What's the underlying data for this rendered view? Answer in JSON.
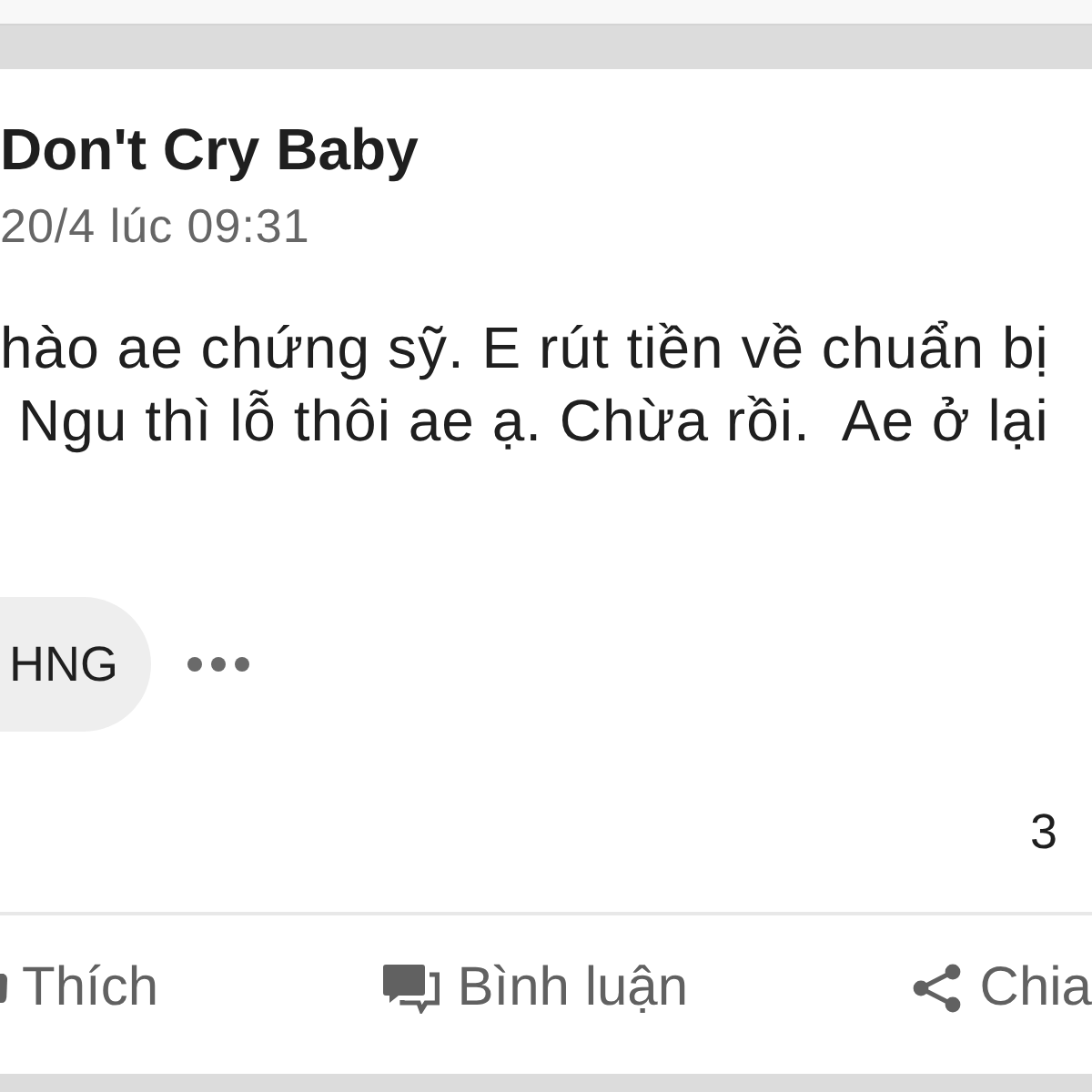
{
  "post": {
    "author": "Don't Cry Baby",
    "time": "20/4 lúc 09:31",
    "text_lines": [
      "hào ae chứng sỹ. E rút tiền về chuẩn bị",
      "Ngu thì lỗ thôi ae ạ. Chừa rồi.  Ae ở lại"
    ],
    "tag": "HNG",
    "count": "3"
  },
  "actions": [
    {
      "kind": "like",
      "label": "Thích"
    },
    {
      "kind": "comment",
      "label": "Bình luận"
    },
    {
      "kind": "share",
      "label": "Chia"
    }
  ]
}
